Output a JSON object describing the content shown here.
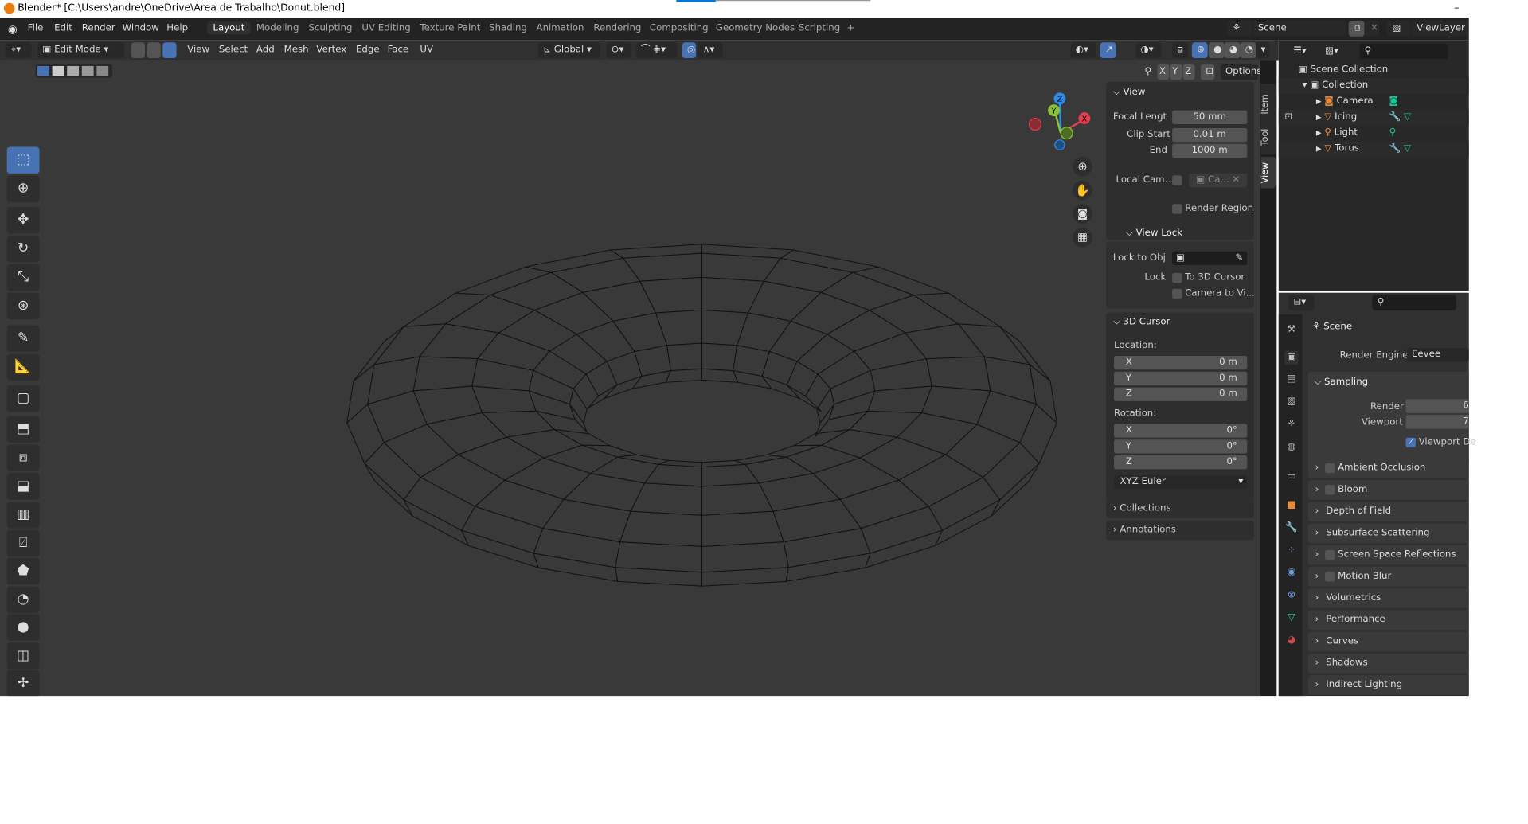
{
  "window": {
    "title": "Blender* [C:\\Users\\andre\\OneDrive\\Área de Trabalho\\Donut.blend]",
    "minimize": "–"
  },
  "menu": [
    "File",
    "Edit",
    "Render",
    "Window",
    "Help"
  ],
  "workspaces": [
    "Layout",
    "Modeling",
    "Sculpting",
    "UV Editing",
    "Texture Paint",
    "Shading",
    "Animation",
    "Rendering",
    "Compositing",
    "Geometry Nodes",
    "Scripting",
    "+"
  ],
  "active_workspace": "Layout",
  "scene": "Scene",
  "view_layer": "ViewLayer",
  "header": {
    "mode": "Edit Mode",
    "menus": [
      "View",
      "Select",
      "Add",
      "Mesh",
      "Vertex",
      "Edge",
      "Face",
      "UV"
    ],
    "orientation": "Global",
    "axes": [
      "X",
      "Y",
      "Z"
    ],
    "options": "Options"
  },
  "gizmo": {
    "x": "X",
    "y": "Y",
    "z": "Z"
  },
  "npanel": {
    "tabs": [
      "Item",
      "Tool",
      "View"
    ],
    "view": {
      "title": "View",
      "focal_label": "Focal Lengt",
      "focal": "50 mm",
      "clip_start_label": "Clip Start",
      "clip_start": "0.01 m",
      "end_label": "End",
      "end": "1000 m",
      "local_cam_label": "Local Cam...",
      "local_cam": "Ca...",
      "render_region": "Render Region"
    },
    "view_lock": {
      "title": "View Lock",
      "lock_obj_label": "Lock to Obj",
      "lock_label": "Lock",
      "to_cursor": "To 3D Cursor",
      "camera_to_view": "Camera to Vi..."
    },
    "cursor": {
      "title": "3D Cursor",
      "location": "Location:",
      "loc": [
        [
          "X",
          "0 m"
        ],
        [
          "Y",
          "0 m"
        ],
        [
          "Z",
          "0 m"
        ]
      ],
      "rotation": "Rotation:",
      "rot": [
        [
          "X",
          "0°"
        ],
        [
          "Y",
          "0°"
        ],
        [
          "Z",
          "0°"
        ]
      ],
      "mode": "XYZ Euler"
    },
    "collections": "Collections",
    "annotations": "Annotations"
  },
  "outliner": {
    "root": "Scene Collection",
    "collection": "Collection",
    "items": [
      "Camera",
      "Icing",
      "Light",
      "Torus"
    ]
  },
  "properties": {
    "scene": "Scene",
    "render_engine_label": "Render Engine",
    "render_engine": "Eevee",
    "sampling": "Sampling",
    "render_label": "Render",
    "render_value": "6",
    "viewport_label": "Viewport",
    "viewport_value": "7",
    "viewport_denoise": "Viewport De",
    "panels": [
      "Ambient Occlusion",
      "Bloom",
      "Depth of Field",
      "Subsurface Scattering",
      "Screen Space Reflections",
      "Motion Blur",
      "Volumetrics",
      "Performance",
      "Curves",
      "Shadows",
      "Indirect Lighting"
    ],
    "panel_checkbox": [
      true,
      true,
      false,
      false,
      true,
      true,
      false,
      false,
      false,
      false,
      false
    ]
  },
  "colors": {
    "accent": "#4772b3",
    "x_axis": "#e0404f",
    "y_axis": "#8ac33a",
    "z_axis": "#2d8ceb",
    "object": "#e38a3c",
    "data": "#17c596"
  }
}
